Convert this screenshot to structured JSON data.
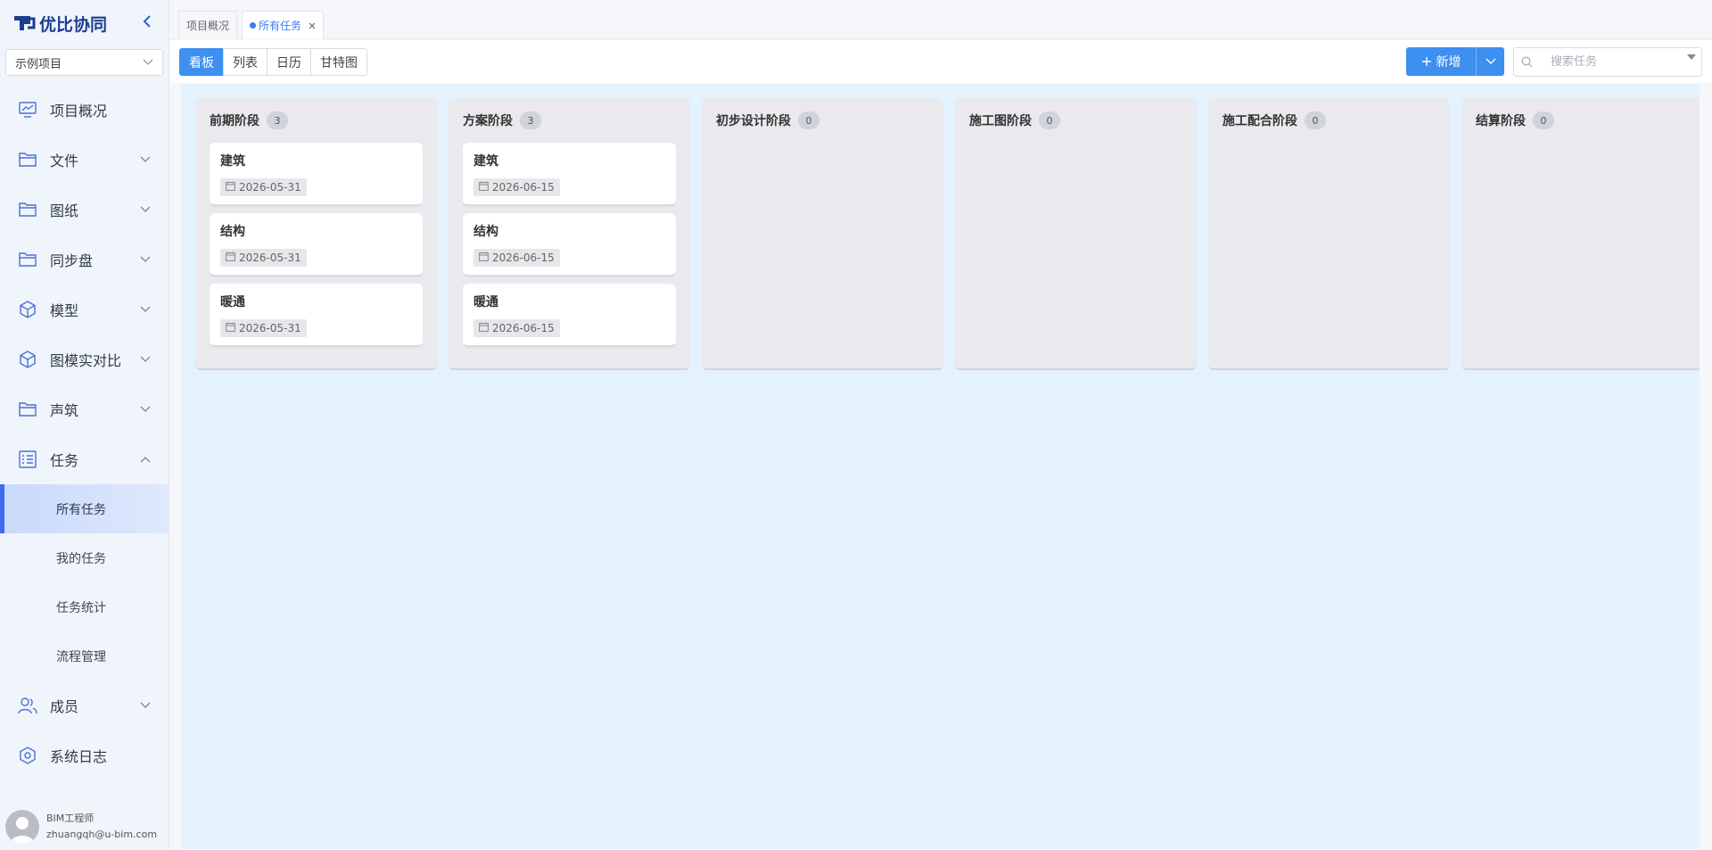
{
  "app": {
    "name": "优比协同"
  },
  "sidebar": {
    "project": "示例项目",
    "nav": [
      {
        "label": "项目概况",
        "icon": "monitor-chart-icon",
        "expandable": false
      },
      {
        "label": "文件",
        "icon": "folder-icon",
        "expandable": true
      },
      {
        "label": "图纸",
        "icon": "folder-icon",
        "expandable": true
      },
      {
        "label": "同步盘",
        "icon": "folder-icon",
        "expandable": true
      },
      {
        "label": "模型",
        "icon": "cube-icon",
        "expandable": true
      },
      {
        "label": "图模实对比",
        "icon": "cube-icon",
        "expandable": true
      },
      {
        "label": "声筑",
        "icon": "folder-icon",
        "expandable": true
      },
      {
        "label": "任务",
        "icon": "task-list-icon",
        "expandable": true,
        "expanded": true
      }
    ],
    "task_sub": [
      {
        "label": "所有任务",
        "active": true
      },
      {
        "label": "我的任务"
      },
      {
        "label": "任务统计"
      },
      {
        "label": "流程管理"
      }
    ],
    "nav_after": [
      {
        "label": "成员",
        "icon": "users-icon",
        "expandable": true
      },
      {
        "label": "系统日志",
        "icon": "hexagon-gear-icon",
        "expandable": false
      }
    ],
    "user": {
      "role": "BIM工程师",
      "email": "zhuangqh@u-bim.com"
    }
  },
  "tabs": [
    {
      "label": "项目概况",
      "active": false
    },
    {
      "label": "所有任务",
      "active": true
    }
  ],
  "toolbar": {
    "views": [
      "看板",
      "列表",
      "日历",
      "甘特图"
    ],
    "active_view": "看板",
    "add_label": "新增",
    "search_placeholder": "搜索任务"
  },
  "board": {
    "columns": [
      {
        "title": "前期阶段",
        "count": "3",
        "cards": [
          {
            "title": "建筑",
            "date": "2026-05-31"
          },
          {
            "title": "结构",
            "date": "2026-05-31"
          },
          {
            "title": "暖通",
            "date": "2026-05-31"
          }
        ]
      },
      {
        "title": "方案阶段",
        "count": "3",
        "cards": [
          {
            "title": "建筑",
            "date": "2026-06-15"
          },
          {
            "title": "结构",
            "date": "2026-06-15"
          },
          {
            "title": "暖通",
            "date": "2026-06-15"
          }
        ]
      },
      {
        "title": "初步设计阶段",
        "count": "0",
        "cards": []
      },
      {
        "title": "施工图阶段",
        "count": "0",
        "cards": []
      },
      {
        "title": "施工配合阶段",
        "count": "0",
        "cards": []
      },
      {
        "title": "结算阶段",
        "count": "0",
        "cards": []
      }
    ]
  },
  "colors": {
    "accent": "#3d8ff0",
    "active_bar": "#3c6df0",
    "board_bg": "#e4f2fd",
    "column_bg": "#e9e9ee"
  }
}
